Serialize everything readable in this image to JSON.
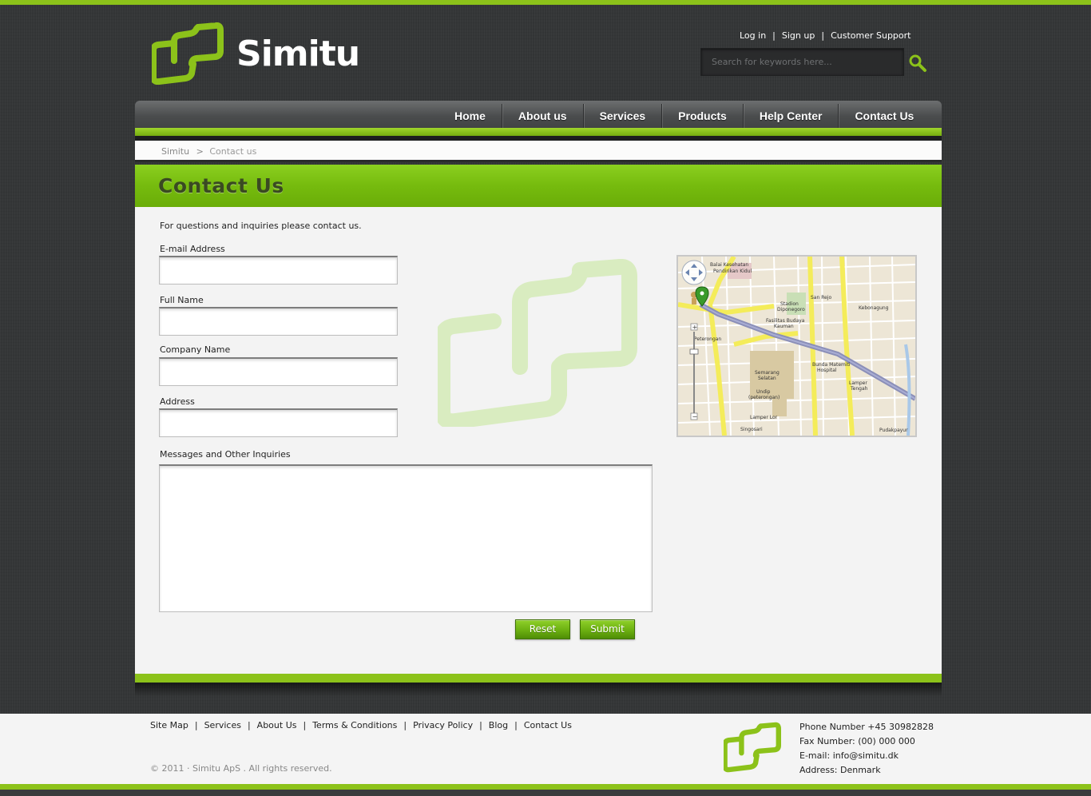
{
  "brand": {
    "name": "Simitu"
  },
  "top_links": [
    {
      "label": "Log in"
    },
    {
      "label": "Sign up"
    },
    {
      "label": "Customer Support"
    }
  ],
  "top_link_separator": "|",
  "search": {
    "placeholder": "Search for keywords here...",
    "value": ""
  },
  "nav": {
    "items": [
      {
        "label": "Home"
      },
      {
        "label": "About us"
      },
      {
        "label": "Services"
      },
      {
        "label": "Products"
      },
      {
        "label": "Help Center"
      },
      {
        "label": "Contact Us"
      }
    ],
    "active": "Contact Us"
  },
  "breadcrumb": {
    "root": "Simitu",
    "separator": ">",
    "current": "Contact us"
  },
  "page": {
    "title": "Contact Us",
    "intro": "For questions and inquiries please contact us."
  },
  "form": {
    "email_label": "E-mail Address",
    "fullname_label": "Full Name",
    "company_label": "Company Name",
    "address_label": "Address",
    "messages_label": "Messages and Other Inquiries",
    "reset_label": "Reset",
    "submit_label": "Submit"
  },
  "map": {
    "labels": {
      "balai": "Balai Kesehatan",
      "pendirikan": "Pendirikan Kidul",
      "stadion": "Stadion",
      "diponegoro": "Diponegoro",
      "sanrejo": "San Rejo",
      "kebonagung": "Kebonagung",
      "fasilitas": "Fasilitas Budaya",
      "kauman": "Kauman",
      "peterongan": "Peterongan",
      "semarang": "Semarang",
      "selatan": "Selatan",
      "bunda": "Bunda Matemiti",
      "hospital": "Hospital",
      "lamper": "Lamper",
      "tengah": "Tengah",
      "undip": "Undip",
      "peterongan2": "(peterongan)",
      "lamperlor": "Lamper Lor",
      "pudakpayung": "Pudakpayur",
      "singosari": "Singosari"
    }
  },
  "footer": {
    "links": [
      {
        "label": "Site Map"
      },
      {
        "label": "Services"
      },
      {
        "label": "About Us"
      },
      {
        "label": "Terms & Conditions"
      },
      {
        "label": "Privacy Policy"
      },
      {
        "label": "Blog"
      },
      {
        "label": "Contact Us"
      }
    ],
    "separator": "|",
    "copyright": "© 2011 · Simitu ApS . All rights reserved.",
    "phone": "Phone Number +45 30982828",
    "fax": "Fax Number: (00) 000 000",
    "email": "E-mail: info@simitu.dk",
    "address": "Address: Denmark"
  },
  "colors": {
    "accent_green": "#8cc21a",
    "dark_bg": "#343637",
    "content_bg": "#f3f3f3"
  },
  "icons": {
    "search": "magnifier-icon",
    "logo": "simitu-logo-icon"
  }
}
